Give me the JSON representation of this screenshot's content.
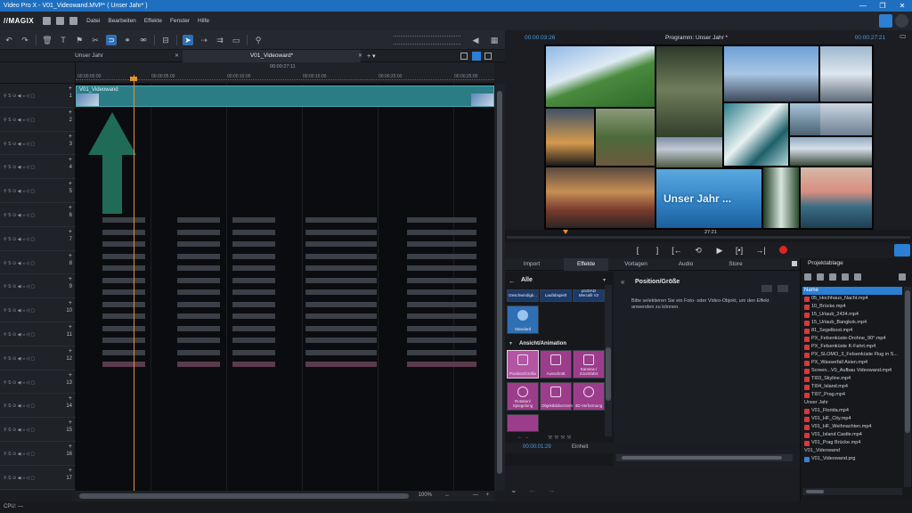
{
  "window": {
    "title": "Video Pro X - V01_Videowand.MVP* ( Unser Jahr* )",
    "controls": [
      "—",
      "❐",
      "✕"
    ]
  },
  "menu": {
    "logo": "//MAGIX",
    "items": [
      "Datei",
      "Bearbeiten",
      "Effekte",
      "Fenster",
      "Hilfe"
    ]
  },
  "tabs": {
    "left": "Unser Jahr",
    "right": "V01_Videoward*",
    "add": "+ ▾"
  },
  "ruler": {
    "timecode": "00:00:27:11",
    "labels": [
      "00:00:00:00",
      "00:00:05:00",
      "00:00:10:00",
      "00:00:15:00",
      "00:00:20:00",
      "00:00:25:00"
    ]
  },
  "tracks": [
    "1",
    "2",
    "3",
    "4",
    "5",
    "6",
    "7",
    "8",
    "9",
    "10",
    "11",
    "12",
    "13",
    "14",
    "15",
    "16",
    "17"
  ],
  "clip": {
    "name": "V01_Videowand"
  },
  "timeline_scroll": {
    "zoom": "100%"
  },
  "status": {
    "cpu": "CPU: —"
  },
  "monitor": {
    "tc_left": "00:00:03:26",
    "title": "Programm: Unser Jahr *",
    "tc_right": "00:00:27:21",
    "overlay_title": "Unser Jahr ..."
  },
  "mini_timeline": {
    "position": "27:21"
  },
  "transport": {
    "buttons": [
      "[",
      "]",
      "[←",
      "⟲",
      "▶",
      "[•]",
      "→|"
    ]
  },
  "effects": {
    "tabs": [
      "Import",
      "Effekte",
      "Vorlagen",
      "Audio",
      "Store"
    ],
    "active_tab": "Effekte",
    "category": "Alle",
    "top_tiles": [
      "Geschwindigk...",
      "Laufabspielt",
      "proDAD Mercalli V2"
    ],
    "standard_tile": "Standard",
    "section": "Ansicht/Animation",
    "tiles": [
      "Position/Größe",
      "Ausschnitt",
      "Kamera-/ Zoomfahrt",
      "Rotation/ Spiegelung",
      "Objektbildverzerrung",
      "3D-Verformung"
    ]
  },
  "position_panel": {
    "title": "Position/Größe",
    "description": "Bitte selektieren Sie ein Foto- oder Video-Objekt, um den Effekt anwenden zu können."
  },
  "effects_footer": {
    "timecode": "00:00:01:29",
    "unit": "Einheit"
  },
  "project": {
    "title": "Projektablage",
    "column": "Name",
    "files_top": [
      "05_Hochhaus_Nacht.mp4",
      "10_Brücke.mp4",
      "15_Urlaub_2434.mp4",
      "15_Urlaub_Bangkok.mp4",
      "81_Segelboot.mp4",
      "PX_Felsenküste-Drohne_90°.mp4",
      "PX_Felsenküste K-Fahrt.mp4",
      "PX_SLOMO_3_Felsenküste Flug in S...",
      "PX_Wasserfall Asien.mp4",
      "Screen...V0_Aufbau Videowand.mp4",
      "TI03_Skyline.mp4",
      "TI04_Island.mp4",
      "TI07_Prag.mp4"
    ],
    "folder1": "Unser Jahr",
    "files_mid": [
      "V01_Florida.mp4",
      "V01_HF_City.mp4",
      "V01_HF_Weihnachten.mp4",
      "V01_Island Castle.mp4",
      "V01_Prag Brücke.mp4"
    ],
    "folder2": "V01_Videowand",
    "files_bottom": [
      "V01_Videowand.prg"
    ]
  }
}
